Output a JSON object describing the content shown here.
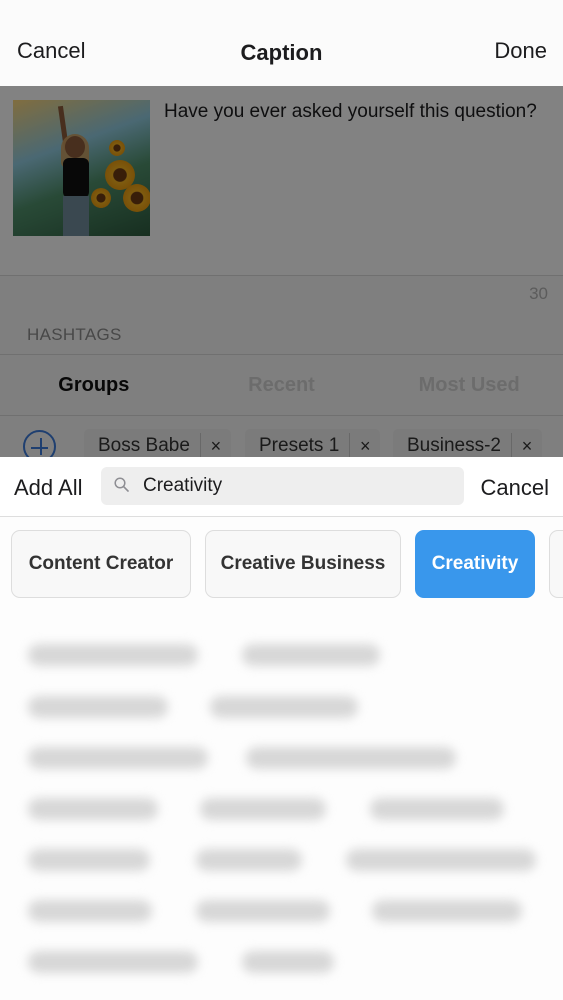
{
  "navbar": {
    "cancel_label": "Cancel",
    "title": "Caption",
    "done_label": "Done"
  },
  "caption": {
    "text": "Have you ever asked yourself this question?",
    "thumbnail_icon": "photo-thumbnail",
    "char_count": "30"
  },
  "hashtags": {
    "section_label": "HASHTAGS",
    "tabs": [
      {
        "label": "Groups",
        "active": true
      },
      {
        "label": "Recent",
        "active": false
      },
      {
        "label": "Most Used",
        "active": false
      }
    ],
    "add_group_icon": "plus-circle-icon",
    "groups": [
      {
        "label": "Boss Babe",
        "remove": "×"
      },
      {
        "label": "Presets 1",
        "remove": "×"
      },
      {
        "label": "Business-2",
        "remove": "×"
      }
    ]
  },
  "search": {
    "add_all_label": "Add All",
    "icon": "search-icon",
    "value": "Creativity",
    "cancel_label": "Cancel"
  },
  "categories": [
    {
      "label": "Content Creator",
      "selected": false
    },
    {
      "label": "Creative Business",
      "selected": false
    },
    {
      "label": "Creativity",
      "selected": true
    },
    {
      "label": "",
      "selected": false
    }
  ],
  "colors": {
    "accent": "#3997ec",
    "add_icon": "#3c7ad6"
  }
}
